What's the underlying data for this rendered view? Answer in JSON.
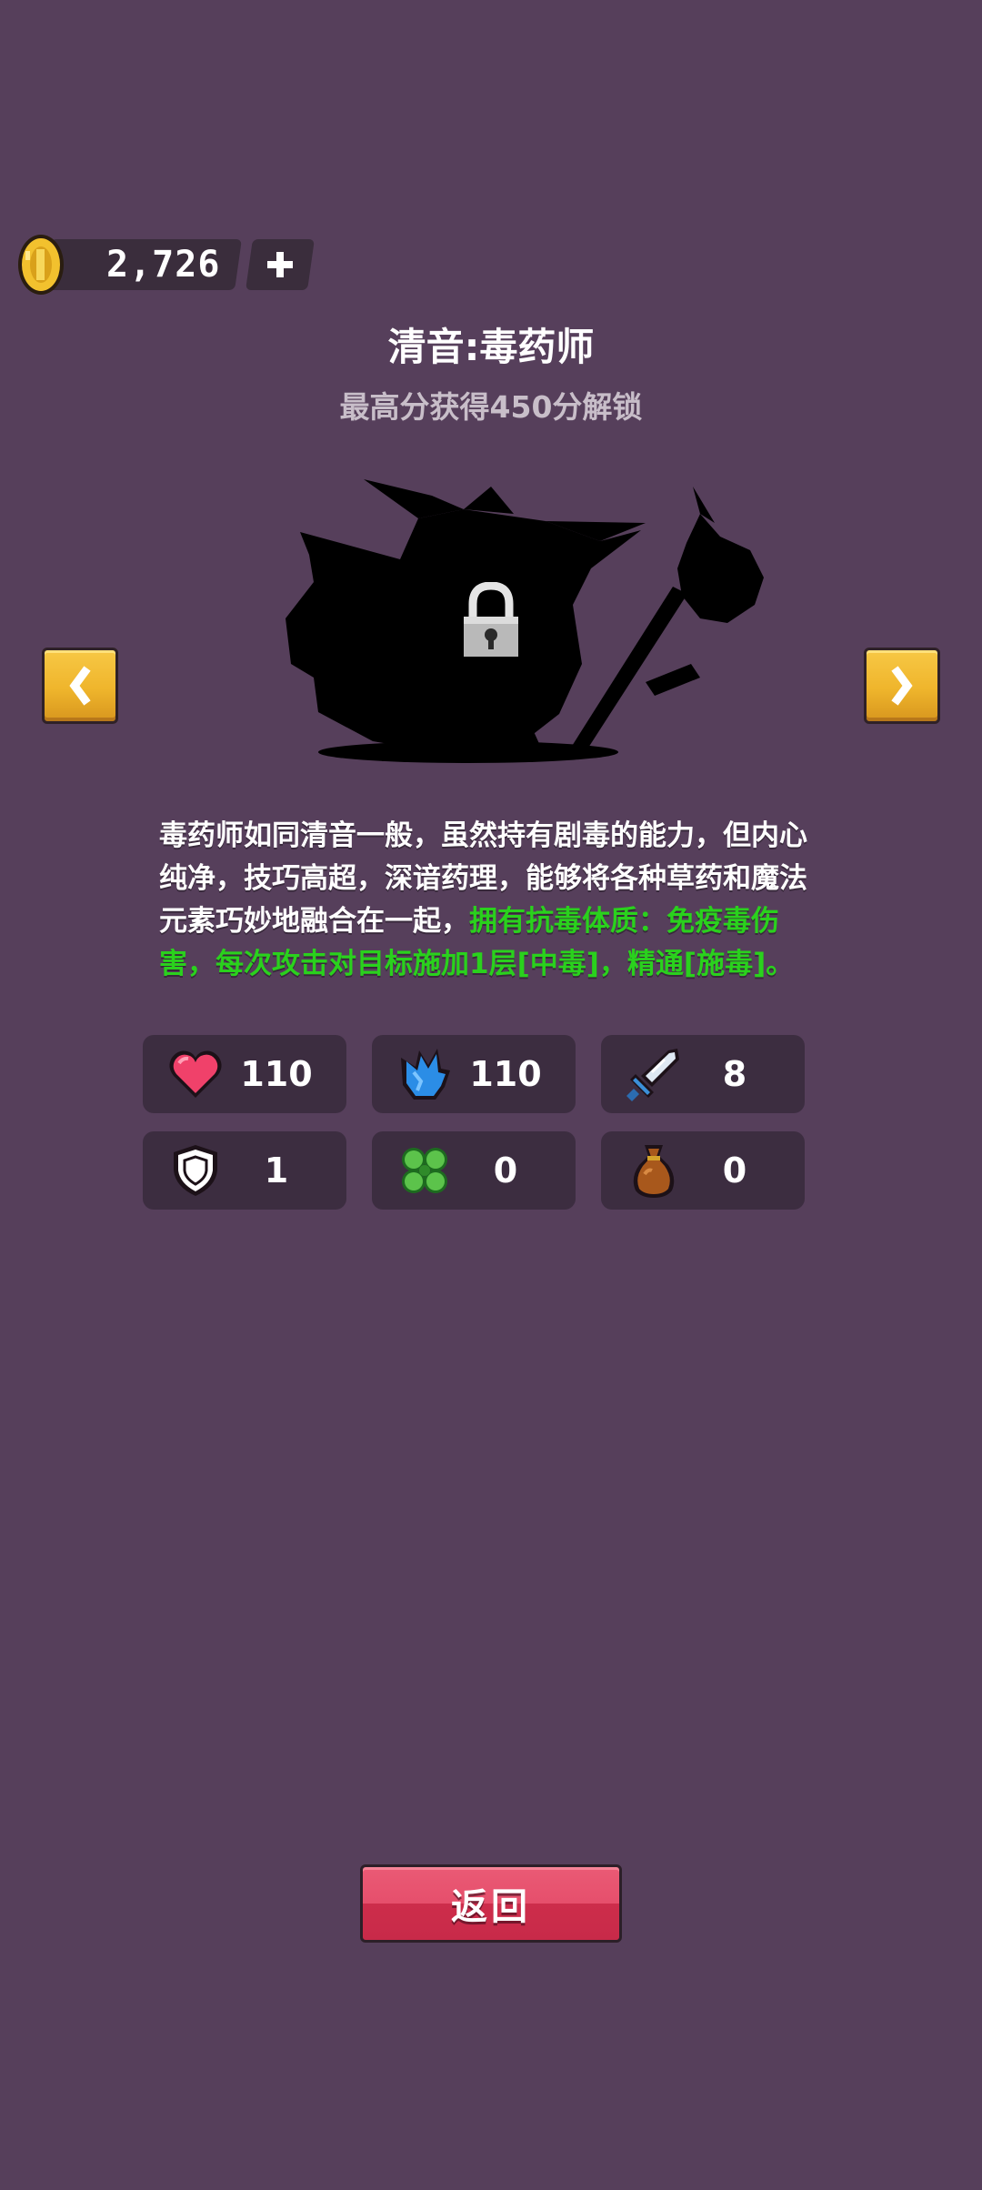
{
  "currency": {
    "amount": "2,726",
    "coin_icon": "gold-coin-icon",
    "add_icon": "plus-icon"
  },
  "character": {
    "name": "清音:毒药师",
    "unlock_condition": "最高分获得450分解锁",
    "locked": true,
    "description_normal": "毒药师如同清音一般，虽然持有剧毒的能力，但内心纯净，技巧高超，深谙药理，能够将各种草药和魔法元素巧妙地融合在一起，",
    "description_highlight": "拥有抗毒体质：免疫毒伤害，每次攻击对目标施加1层[中毒]，精通[施毒]。"
  },
  "navigation": {
    "prev_icon": "chevron-left-icon",
    "next_icon": "chevron-right-icon"
  },
  "stats": [
    {
      "icon": "heart-icon",
      "value": "110"
    },
    {
      "icon": "energy-crystal-icon",
      "value": "110"
    },
    {
      "icon": "sword-icon",
      "value": "8"
    },
    {
      "icon": "shield-icon",
      "value": "1"
    },
    {
      "icon": "clover-icon",
      "value": "0"
    },
    {
      "icon": "money-bag-icon",
      "value": "0"
    }
  ],
  "back_button": {
    "label": "返回"
  },
  "colors": {
    "background": "#563f5b",
    "card": "#3c2d40",
    "highlight_text": "#2ad11d",
    "arrow_button": "#efb52c",
    "back_button": "#e64f6c"
  }
}
